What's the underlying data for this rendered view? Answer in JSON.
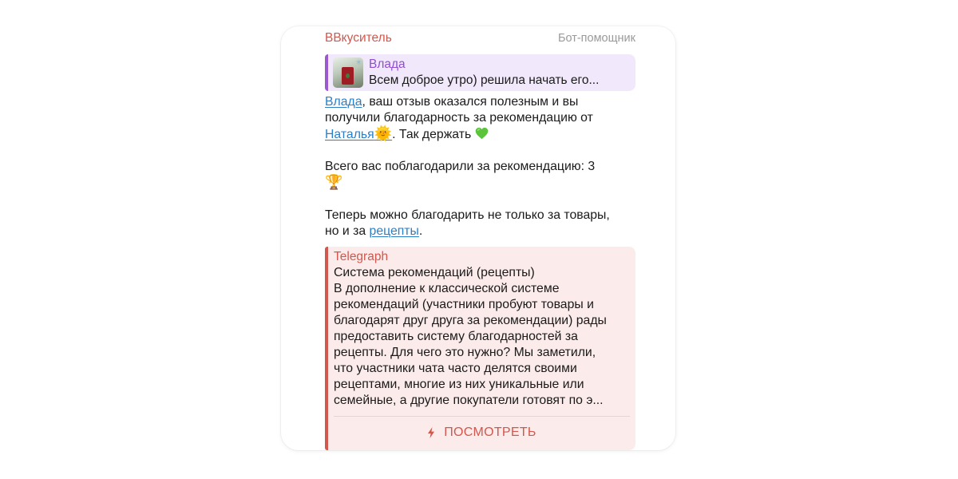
{
  "message": {
    "sender": "ВВкуситель",
    "sender_role": "Бот-помощник",
    "reply": {
      "name": "Влада",
      "text": "Всем доброе утро) решила начать его..."
    },
    "body": {
      "mention_1": "Влада",
      "line_1_rest": ", ваш отзыв оказался полезным и вы",
      "line_2": "получили благодарность за рекомендацию от",
      "mention_2": "Наталья",
      "mention_2_emoji": "🌞",
      "after_mention_2": ". Так держать ",
      "total_text": "Всего вас поблагодарили за рекомендацию: 3",
      "trophy": "🏆",
      "now_line_1": "Теперь можно благодарить не только за товары,",
      "now_line_2_start": "но и за ",
      "recipes_link": "рецепты",
      "now_line_2_end": "."
    },
    "link_preview": {
      "site_name": "Telegraph",
      "title": "Система рекомендаций (рецепты)",
      "description_lines": [
        "В дополнение к классической системе",
        "рекомендаций (участники пробуют товары и",
        "благодарят друг друга за рекомендации) рады",
        "предоставить систему благодарностей за",
        "рецепты. Для чего это нужно? Мы заметили,",
        "что участники чата часто делятся своими",
        "рецептами, многие из них уникальные или",
        "семейные, а другие покупатели готовят по э..."
      ],
      "button_label": "ПОСМОТРЕТЬ",
      "button_icon": "lightning-icon"
    }
  },
  "colors": {
    "accent_red": "#d2574c",
    "reply_purple": "#9b59d0",
    "link_blue": "#2a7fc9",
    "heart_green": "#5cc43a"
  }
}
